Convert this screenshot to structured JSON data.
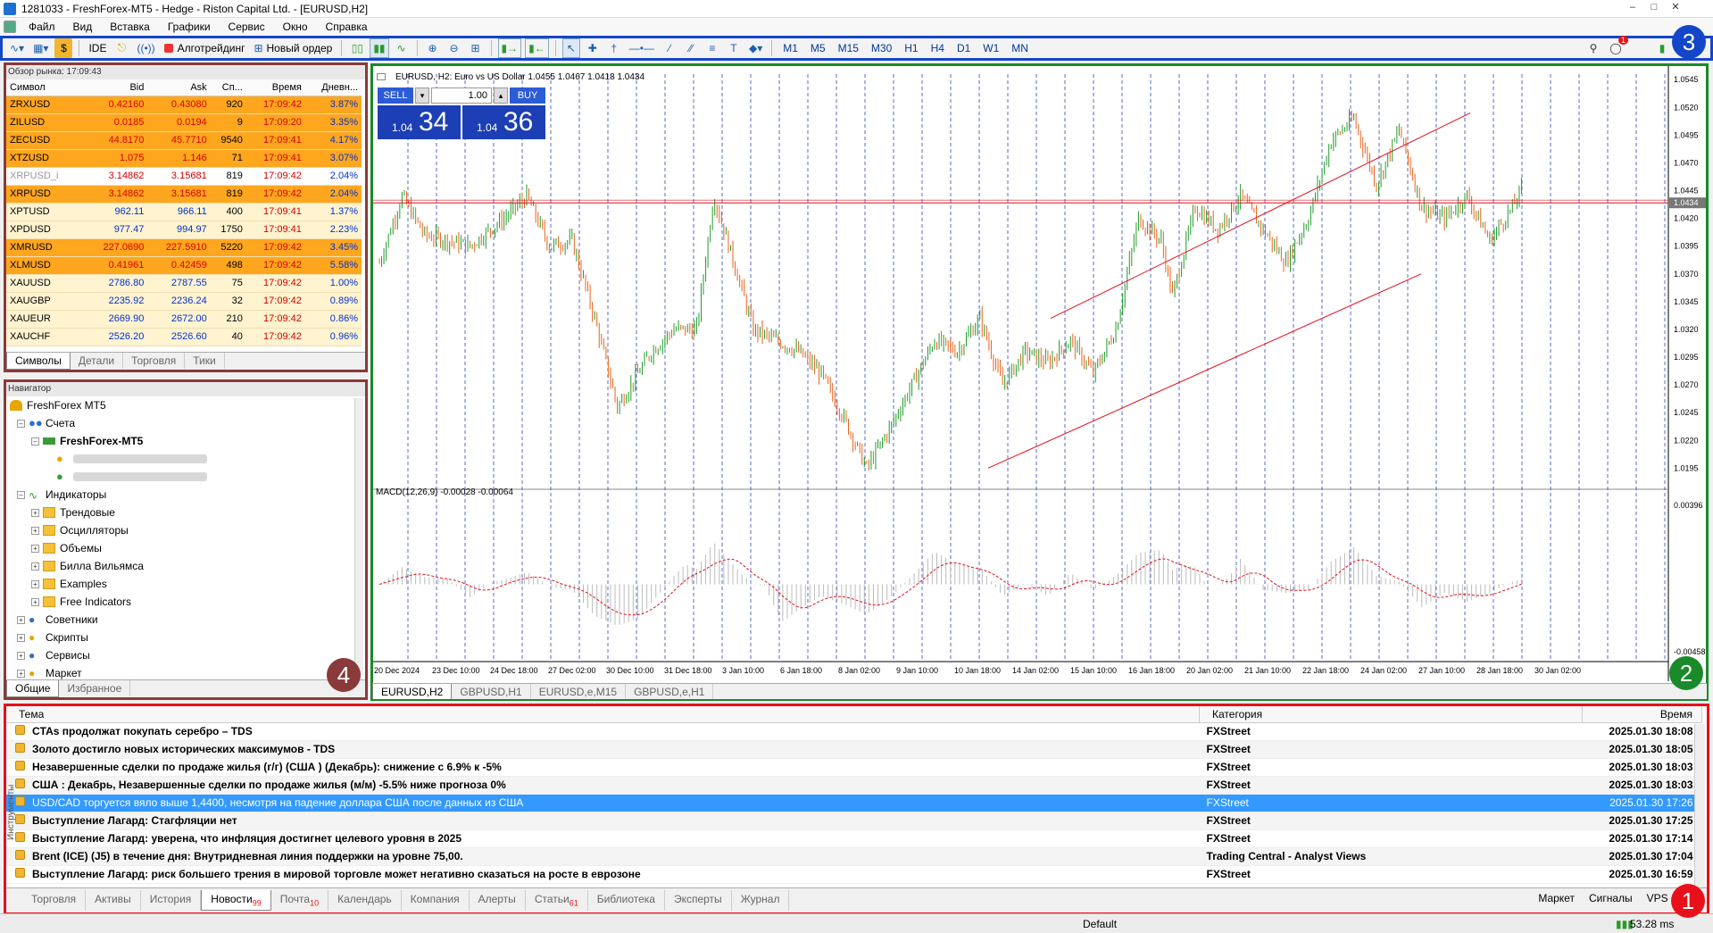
{
  "window": {
    "title": "1281033 - FreshForex-MT5 - Hedge - Riston Capital Ltd. - [EURUSD,H2]"
  },
  "menu": [
    "Файл",
    "Вид",
    "Вставка",
    "Графики",
    "Сервис",
    "Окно",
    "Справка"
  ],
  "toolbar": {
    "ide": "IDE",
    "algo": "Алготрейдинг",
    "new_order": "Новый ордер",
    "timeframes": [
      "M1",
      "M5",
      "M15",
      "M30",
      "H1",
      "H4",
      "D1",
      "W1",
      "MN"
    ],
    "notif_count": "1"
  },
  "market_watch": {
    "header": "Обзор рынка: 17:09:43",
    "columns": [
      "Символ",
      "Bid",
      "Ask",
      "Сп...",
      "Время",
      "Дневн..."
    ],
    "rows": [
      {
        "symbol": "ZRXUSD",
        "bid": "0.42160",
        "ask": "0.43080",
        "spread": "920",
        "time": "17:09:42",
        "daily": "3.87%",
        "style": "hot"
      },
      {
        "symbol": "ZILUSD",
        "bid": "0.0185",
        "ask": "0.0194",
        "spread": "9",
        "time": "17:09:20",
        "daily": "3.35%",
        "style": "hot"
      },
      {
        "symbol": "ZECUSD",
        "bid": "44.8170",
        "ask": "45.7710",
        "spread": "9540",
        "time": "17:09:41",
        "daily": "4.17%",
        "style": "hot"
      },
      {
        "symbol": "XTZUSD",
        "bid": "1.075",
        "ask": "1.146",
        "spread": "71",
        "time": "17:09:41",
        "daily": "3.07%",
        "style": "hot"
      },
      {
        "symbol": "XRPUSD_i",
        "bid": "3.14862",
        "ask": "3.15681",
        "spread": "819",
        "time": "17:09:42",
        "daily": "2.04%",
        "style": "plain"
      },
      {
        "symbol": "XRPUSD",
        "bid": "3.14862",
        "ask": "3.15681",
        "spread": "819",
        "time": "17:09:42",
        "daily": "2.04%",
        "style": "hot"
      },
      {
        "symbol": "XPTUSD",
        "bid": "962.11",
        "ask": "966.11",
        "spread": "400",
        "time": "17:09:41",
        "daily": "1.37%",
        "style": "warm"
      },
      {
        "symbol": "XPDUSD",
        "bid": "977.47",
        "ask": "994.97",
        "spread": "1750",
        "time": "17:09:41",
        "daily": "2.23%",
        "style": "warm"
      },
      {
        "symbol": "XMRUSD",
        "bid": "227.0690",
        "ask": "227.5910",
        "spread": "5220",
        "time": "17:09:42",
        "daily": "3.45%",
        "style": "hot"
      },
      {
        "symbol": "XLMUSD",
        "bid": "0.41961",
        "ask": "0.42459",
        "spread": "498",
        "time": "17:09:42",
        "daily": "5.58%",
        "style": "hot"
      },
      {
        "symbol": "XAUUSD",
        "bid": "2786.80",
        "ask": "2787.55",
        "spread": "75",
        "time": "17:09:42",
        "daily": "1.00%",
        "style": "warm"
      },
      {
        "symbol": "XAUGBP",
        "bid": "2235.92",
        "ask": "2236.24",
        "spread": "32",
        "time": "17:09:42",
        "daily": "0.89%",
        "style": "warm"
      },
      {
        "symbol": "XAUEUR",
        "bid": "2669.90",
        "ask": "2672.00",
        "spread": "210",
        "time": "17:09:42",
        "daily": "0.86%",
        "style": "warm"
      },
      {
        "symbol": "XAUCHF",
        "bid": "2526.20",
        "ask": "2526.60",
        "spread": "40",
        "time": "17:09:42",
        "daily": "0.96%",
        "style": "warm"
      }
    ],
    "tabs": [
      "Символы",
      "Детали",
      "Торговля",
      "Тики"
    ]
  },
  "navigator": {
    "header": "Навигатор",
    "root": "FreshForex MT5",
    "accounts": "Счета",
    "account": "FreshForex-MT5",
    "indicators": "Индикаторы",
    "folders": [
      "Трендовые",
      "Осцилляторы",
      "Объемы",
      "Билла Вильямса",
      "Examples",
      "Free Indicators"
    ],
    "others": [
      "Советники",
      "Скрипты",
      "Сервисы",
      "Маркет"
    ],
    "tabs": [
      "Общие",
      "Избранное"
    ]
  },
  "chart": {
    "info": "EURUSD, H2:  Euro vs US Dollar  1.0455 1.0467 1.0418 1.0434",
    "sell": "SELL",
    "buy": "BUY",
    "lot": "1.00",
    "bid_prefix": "1.04",
    "bid_big": "34",
    "ask_prefix": "1.04",
    "ask_big": "36",
    "macd_label": "MACD(12,26,9) -0.00028 -0.00064",
    "price_labels": [
      "1.0545",
      "1.0520",
      "1.0495",
      "1.0470",
      "1.0445",
      "1.0420",
      "1.0395",
      "1.0370",
      "1.0345",
      "1.0320",
      "1.0295",
      "1.0270",
      "1.0245",
      "1.0220",
      "1.0195"
    ],
    "current_price": "1.0434",
    "macd_top": "0.00396",
    "macd_bottom": "-0.00458",
    "dates": [
      "20 Dec 2024",
      "23 Dec 10:00",
      "24 Dec 18:00",
      "27 Dec 02:00",
      "30 Dec 10:00",
      "31 Dec 18:00",
      "3 Jan 10:00",
      "6 Jan 18:00",
      "8 Jan 02:00",
      "9 Jan 10:00",
      "10 Jan 18:00",
      "14 Jan 02:00",
      "15 Jan 10:00",
      "16 Jan 18:00",
      "20 Jan 02:00",
      "21 Jan 10:00",
      "22 Jan 18:00",
      "24 Jan 02:00",
      "27 Jan 10:00",
      "28 Jan 18:00",
      "30 Jan 02:00"
    ],
    "tabs": [
      "EURUSD,H2",
      "GBPUSD,H1",
      "EURUSD,e,M15",
      "GBPUSD,e,H1"
    ]
  },
  "news": {
    "columns": [
      "Тема",
      "Категория",
      "Время"
    ],
    "rows": [
      {
        "topic": "CTAs продолжат покупать серебро – TDS",
        "cat": "FXStreet",
        "time": "2025.01.30 18:08"
      },
      {
        "topic": "Золото достигло новых исторических максимумов - TDS",
        "cat": "FXStreet",
        "time": "2025.01.30 18:05"
      },
      {
        "topic": "Незавершенные сделки по продаже жилья (г/г) (США ) (Декабрь): снижение с 6.9% к -5%",
        "cat": "FXStreet",
        "time": "2025.01.30 18:03"
      },
      {
        "topic": "США : Декабрь, Незавершенные сделки по продаже жилья (м/м)   -5.5% ниже прогноза 0%",
        "cat": "FXStreet",
        "time": "2025.01.30 18:03"
      },
      {
        "topic": "USD/CAD торгуется вяло выше 1,4400, несмотря на падение доллара США после данных из США",
        "cat": "FXStreet",
        "time": "2025.01.30 17:26"
      },
      {
        "topic": "Выступление Лагард: Стагфляции нет",
        "cat": "FXStreet",
        "time": "2025.01.30 17:25"
      },
      {
        "topic": "Выступление Лагард: уверена, что инфляция достигнет целевого уровня в 2025",
        "cat": "FXStreet",
        "time": "2025.01.30 17:14"
      },
      {
        "topic": "Brent (ICE) (J5) в течение дня: Внутридневная линия поддержки на уровне 75,00.",
        "cat": "Trading Central - Analyst Views",
        "time": "2025.01.30 17:04"
      },
      {
        "topic": "Выступление Лагард: риск большего трения в мировой торговле может негативно сказаться на росте в еврозоне",
        "cat": "FXStreet",
        "time": "2025.01.30 16:59"
      }
    ],
    "side_label": "Инструменты",
    "tabs": [
      {
        "label": "Торговля",
        "count": ""
      },
      {
        "label": "Активы",
        "count": ""
      },
      {
        "label": "История",
        "count": ""
      },
      {
        "label": "Новости",
        "count": "99"
      },
      {
        "label": "Почта",
        "count": "10"
      },
      {
        "label": "Календарь",
        "count": ""
      },
      {
        "label": "Компания",
        "count": ""
      },
      {
        "label": "Алерты",
        "count": ""
      },
      {
        "label": "Статьи",
        "count": "61"
      },
      {
        "label": "Библиотека",
        "count": ""
      },
      {
        "label": "Эксперты",
        "count": ""
      },
      {
        "label": "Журнал",
        "count": ""
      }
    ],
    "right_tabs": [
      "Маркет",
      "Сигналы",
      "VPS",
      "Т"
    ]
  },
  "status": {
    "profile": "Default",
    "ping": "53.28 ms"
  },
  "badges": [
    "1",
    "2",
    "3",
    "4"
  ],
  "colors": {
    "bull": "#1f9b2a",
    "bear": "#e8621b",
    "badge1": "#e8101a",
    "badge2": "#1a8a2a",
    "badge3": "#1346c8",
    "badge4": "#8a3a3a"
  }
}
